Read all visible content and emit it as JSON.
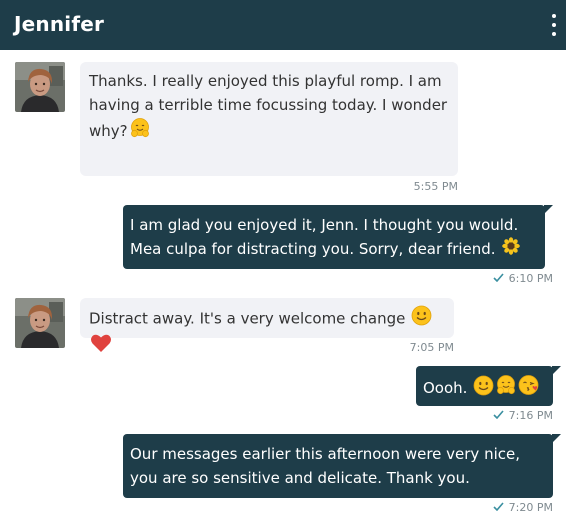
{
  "header": {
    "contact_name": "Jennifer",
    "menu_icon": "kebab-menu-icon"
  },
  "messages": [
    {
      "direction": "incoming",
      "text": "Thanks. I really enjoyed this playful romp. I am having a terrible time focussing today. I wonder why?",
      "emojis": [
        "hugging-face-emoji"
      ],
      "time": "5:55 PM"
    },
    {
      "direction": "outgoing",
      "text": "I am glad you enjoyed it, Jenn. I thought you would. Mea culpa for distracting you. Sorry, dear friend.",
      "emojis": [
        "sunflower-emoji"
      ],
      "time": "6:10 PM",
      "status": "sent"
    },
    {
      "direction": "incoming",
      "text": "Distract away. It's a very welcome change",
      "emojis": [
        "smiling-face-emoji",
        "red-heart-emoji"
      ],
      "time": "7:05 PM"
    },
    {
      "direction": "outgoing",
      "text": "Oooh.",
      "emojis": [
        "smiling-face-emoji",
        "hugging-face-emoji",
        "face-blowing-kiss-emoji"
      ],
      "time": "7:16 PM",
      "status": "sent"
    },
    {
      "direction": "outgoing",
      "text": "Our messages earlier this afternoon were very nice, you are so sensitive and delicate. Thank you.",
      "emojis": [],
      "time": "7:20 PM",
      "status": "sent"
    }
  ],
  "colors": {
    "header_bg": "#1e3d49",
    "outgoing_bubble": "#1e3d49",
    "incoming_bubble": "#f1f2f6",
    "timestamp": "#7f8a90",
    "check": "#3a8fa0"
  }
}
